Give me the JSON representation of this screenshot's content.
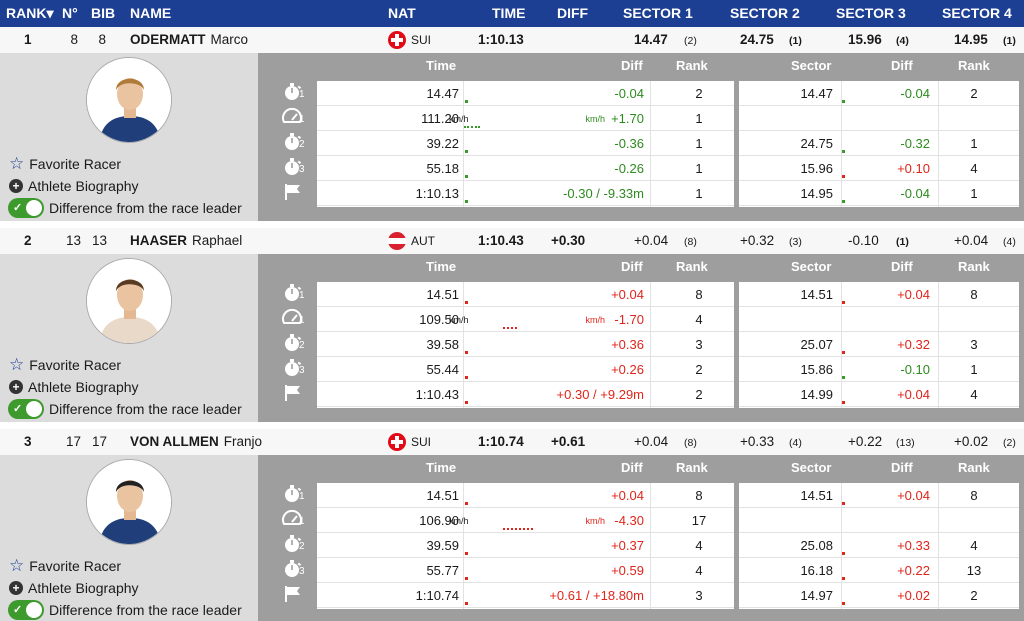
{
  "header": {
    "rank": "RANK▾",
    "no": "N°",
    "bib": "BIB",
    "name": "NAME",
    "nat": "NAT",
    "time": "TIME",
    "diff": "DIFF",
    "s1": "SECTOR 1",
    "s2": "SECTOR 2",
    "s3": "SECTOR 3",
    "s4": "SECTOR 4"
  },
  "colors": {
    "header_bg": "#1c3f93",
    "green": "#2e8b1f",
    "red": "#e0251b"
  },
  "detail_headers": {
    "time": "Time",
    "diff": "Diff",
    "rank": "Rank",
    "sector": "Sector",
    "diff2": "Diff",
    "rank2": "Rank"
  },
  "links": {
    "favorite": "Favorite Racer",
    "bio": "Athlete Biography",
    "leader": "Difference from the race leader"
  },
  "icon_subs": [
    "1",
    "1",
    "2",
    "3"
  ],
  "kmh": "km/h",
  "athletes": [
    {
      "rank": "1",
      "no": "8",
      "bib": "8",
      "surname": "ODERMATT",
      "firstname": "Marco",
      "nat": "SUI",
      "time": "1:10.13",
      "diff": "",
      "s1": "14.47",
      "s1r": "(2)",
      "s2": "24.75",
      "s2r": "(1)",
      "s3": "15.96",
      "s3r": "(4)",
      "s4": "14.95",
      "s4r": "(1)",
      "rows": [
        {
          "time": "14.47",
          "diff": "-0.04",
          "rank": "2",
          "sector": "14.47",
          "sdiff": "-0.04",
          "srank": "2"
        },
        {
          "time": "111.20",
          "diff": "+1.70",
          "rank": "1",
          "sector": "",
          "sdiff": "",
          "srank": ""
        },
        {
          "time": "39.22",
          "diff": "-0.36",
          "rank": "1",
          "sector": "24.75",
          "sdiff": "-0.32",
          "srank": "1"
        },
        {
          "time": "55.18",
          "diff": "-0.26",
          "rank": "1",
          "sector": "15.96",
          "sdiff": "+0.10",
          "srank": "4"
        },
        {
          "time": "1:10.13",
          "diff": "-0.30 / -9.33m",
          "rank": "1",
          "sector": "14.95",
          "sdiff": "-0.04",
          "srank": "1"
        }
      ]
    },
    {
      "rank": "2",
      "no": "13",
      "bib": "13",
      "surname": "HAASER",
      "firstname": "Raphael",
      "nat": "AUT",
      "time": "1:10.43",
      "diff": "+0.30",
      "s1": "+0.04",
      "s1r": "(8)",
      "s2": "+0.32",
      "s2r": "(3)",
      "s3": "-0.10",
      "s3r": "(1)",
      "s4": "+0.04",
      "s4r": "(4)",
      "rows": [
        {
          "time": "14.51",
          "diff": "+0.04",
          "rank": "8",
          "sector": "14.51",
          "sdiff": "+0.04",
          "srank": "8"
        },
        {
          "time": "109.50",
          "diff": "-1.70",
          "rank": "4",
          "sector": "",
          "sdiff": "",
          "srank": ""
        },
        {
          "time": "39.58",
          "diff": "+0.36",
          "rank": "3",
          "sector": "25.07",
          "sdiff": "+0.32",
          "srank": "3"
        },
        {
          "time": "55.44",
          "diff": "+0.26",
          "rank": "2",
          "sector": "15.86",
          "sdiff": "-0.10",
          "srank": "1"
        },
        {
          "time": "1:10.43",
          "diff": "+0.30 / +9.29m",
          "rank": "2",
          "sector": "14.99",
          "sdiff": "+0.04",
          "srank": "4"
        }
      ]
    },
    {
      "rank": "3",
      "no": "17",
      "bib": "17",
      "surname": "VON ALLMEN",
      "firstname": "Franjo",
      "nat": "SUI",
      "time": "1:10.74",
      "diff": "+0.61",
      "s1": "+0.04",
      "s1r": "(8)",
      "s2": "+0.33",
      "s2r": "(4)",
      "s3": "+0.22",
      "s3r": "(13)",
      "s4": "+0.02",
      "s4r": "(2)",
      "rows": [
        {
          "time": "14.51",
          "diff": "+0.04",
          "rank": "8",
          "sector": "14.51",
          "sdiff": "+0.04",
          "srank": "8"
        },
        {
          "time": "106.90",
          "diff": "-4.30",
          "rank": "17",
          "sector": "",
          "sdiff": "",
          "srank": ""
        },
        {
          "time": "39.59",
          "diff": "+0.37",
          "rank": "4",
          "sector": "25.08",
          "sdiff": "+0.33",
          "srank": "4"
        },
        {
          "time": "55.77",
          "diff": "+0.59",
          "rank": "4",
          "sector": "16.18",
          "sdiff": "+0.22",
          "srank": "13"
        },
        {
          "time": "1:10.74",
          "diff": "+0.61 / +18.80m",
          "rank": "3",
          "sector": "14.97",
          "sdiff": "+0.02",
          "srank": "2"
        }
      ]
    }
  ]
}
